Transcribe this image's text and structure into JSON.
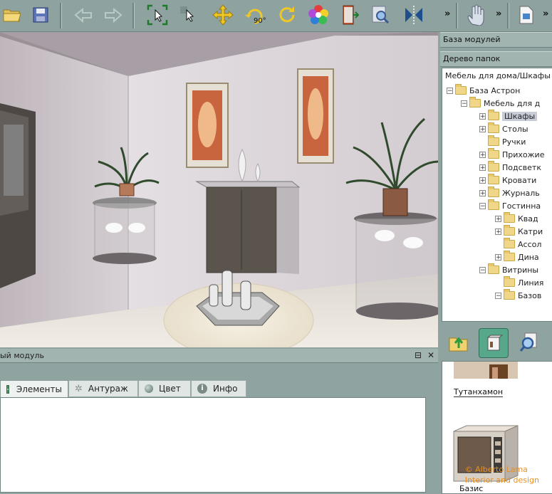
{
  "toolbar": {
    "buttons": [
      "open-folder-icon",
      "save-icon",
      "undo-icon",
      "redo-icon",
      "select-frame-icon",
      "select-move-icon",
      "move-arrows-icon",
      "rotate-90-icon",
      "rotate-icon",
      "color-palette-icon",
      "door-exit-icon",
      "zoom-icon",
      "mirror-icon",
      "hand-pan-icon",
      "document-icon"
    ],
    "rotate_label": "90°",
    "more1": "»",
    "more2": "»",
    "more3": "»"
  },
  "right_panel": {
    "modules_base": "База модулей",
    "folder_tree": "Дерево папок",
    "tree_path": "Мебель для дома/Шкафы",
    "tree": [
      {
        "label": "База Астрон",
        "expander": "−"
      },
      {
        "label": "Мебель для д",
        "expander": "−"
      },
      {
        "label": "Шкафы",
        "expander": "+"
      },
      {
        "label": "Столы",
        "expander": "+"
      },
      {
        "label": "Ручки",
        "expander": ""
      },
      {
        "label": "Прихожие",
        "expander": "+"
      },
      {
        "label": "Подсветк",
        "expander": "+"
      },
      {
        "label": "Кровати",
        "expander": "+"
      },
      {
        "label": "Журналь",
        "expander": "+"
      },
      {
        "label": "Гостинна",
        "expander": "−"
      },
      {
        "label": "Квад",
        "expander": "+"
      },
      {
        "label": "Катри",
        "expander": "+"
      },
      {
        "label": "Ассол",
        "expander": ""
      },
      {
        "label": "Дина",
        "expander": "+"
      },
      {
        "label": "Витрины",
        "expander": "−"
      },
      {
        "label": "Линия",
        "expander": ""
      },
      {
        "label": "Базов",
        "expander": "−"
      }
    ],
    "thumbs": [
      {
        "caption": "Тутанхамон"
      },
      {
        "caption": "Базис"
      }
    ]
  },
  "bottom_panel": {
    "title": "ый модуль",
    "pin": "⊟",
    "close": "✕",
    "tabs": [
      {
        "label": "Элементы",
        "icon": "grid-icon"
      },
      {
        "label": "Антураж",
        "icon": "gear-icon"
      },
      {
        "label": "Цвет",
        "icon": "globe-icon"
      },
      {
        "label": "Инфо",
        "icon": "info-icon"
      }
    ]
  },
  "watermark": {
    "line1": "© Alberto Lama",
    "line2": "Interior and design"
  }
}
